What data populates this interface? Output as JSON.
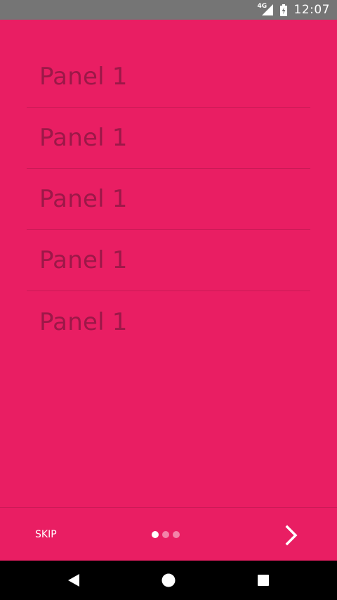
{
  "status_bar": {
    "network": "4G",
    "time": "12:07"
  },
  "panels": [
    {
      "label": "Panel 1"
    },
    {
      "label": "Panel 1"
    },
    {
      "label": "Panel 1"
    },
    {
      "label": "Panel 1"
    },
    {
      "label": "Panel 1"
    }
  ],
  "intro": {
    "skip_label": "SKIP",
    "page_count": 3,
    "current_page": 1
  },
  "icons": {
    "signal": "signal-icon",
    "battery": "battery-charging-icon",
    "next": "chevron-right-icon",
    "back": "back-triangle-icon",
    "home": "home-circle-icon",
    "recents": "recents-square-icon"
  },
  "colors": {
    "background": "#e91e63",
    "status_bar": "#757575",
    "panel_text": "#9c1848",
    "nav_bar": "#000000"
  }
}
